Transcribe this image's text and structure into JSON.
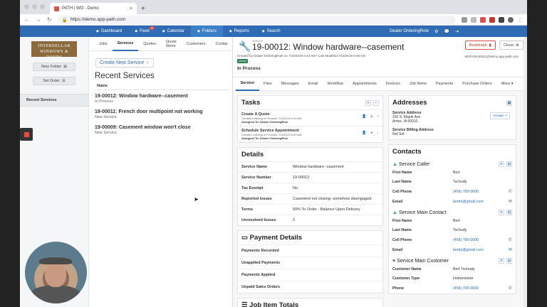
{
  "browser": {
    "tab_title": "PATH | WO - Demo",
    "url": "https://demo.app-path.com",
    "new_tab": "+",
    "close_tab": "×"
  },
  "nav": {
    "items": [
      {
        "label": "Dashboard",
        "icon": "dashboard-icon"
      },
      {
        "label": "Feed",
        "icon": "feed-icon",
        "badge": "6"
      },
      {
        "label": "Calendar",
        "icon": "calendar-icon"
      },
      {
        "label": "Folders",
        "icon": "folder-icon",
        "active": true
      },
      {
        "label": "Reports",
        "icon": "reports-icon"
      },
      {
        "label": "Search",
        "icon": "search-icon"
      }
    ],
    "user": "Dealer OrderingRole"
  },
  "sidebar": {
    "logo_line1": "INTERSELLAR",
    "logo_line2": "WINDOWS & DOORS",
    "new_folder": "New Folder",
    "set_order": "Set Order",
    "section": "Recent Services"
  },
  "middle": {
    "tabs": [
      "Jobs",
      "Services",
      "Quotes",
      "Quote Items",
      "Customers",
      "Contac"
    ],
    "active_tab": "Services",
    "create_button": "Create New Service",
    "heading": "Recent Services",
    "column_header": "Name",
    "services": [
      {
        "title": "19-00012: Window hardware--casement",
        "status": "In Process"
      },
      {
        "title": "19-00011: French door multipoint not working",
        "status": "New Service"
      },
      {
        "title": "19-00009: Casement window won't close",
        "status": "New Service"
      }
    ]
  },
  "detail": {
    "type_label": "SERVICE",
    "title": "19-00012: Window hardware--casement",
    "created_by": "Created by Dealer OrderingRole on 7/15/2019 6:43 AM • Last Modified 7/15/2019 6:49 AM",
    "tag": "#Active",
    "status": "In Process",
    "bookmark": "Bookmark",
    "close": "Close",
    "service_id": "SERV19-00012@demo.app-path.com",
    "tabs": [
      "Service",
      "Files",
      "Messages",
      "Email",
      "Workflow",
      "Appointments",
      "Invoices",
      "Job Items",
      "Payments",
      "Purchase Orders",
      "More"
    ],
    "tasks_heading": "Tasks",
    "tasks": [
      {
        "name": "Create A Quote",
        "meta": "Created entering In Process 7/15/2019 6:49 AM",
        "assigned": "Assigned To: Dealer OrderingRole"
      },
      {
        "name": "Schedule Service Appointment",
        "meta": "Created entering In Process 7/15/2019 6:49 AM",
        "assigned": "Assigned To: Dealer OrderingRole"
      }
    ],
    "details_heading": "Details",
    "details": [
      {
        "k": "Service Name",
        "v": "Window hardware--casement"
      },
      {
        "k": "Service Number",
        "v": "19-00012"
      },
      {
        "k": "Tax Exempt",
        "v": "No"
      },
      {
        "k": "Reported Issues",
        "v": "Casement not closing--somehow disengaged."
      },
      {
        "k": "Terms",
        "v": "50% To Order - Balance Upon Delivery"
      },
      {
        "k": "Unresolved Issues",
        "v": "2"
      }
    ],
    "payment_heading": "Payment Details",
    "payments": [
      "Payments Recorded",
      "Unapplied Payments",
      "Payments Applied",
      "Unpaid Sales Orders"
    ],
    "jobitems_heading": "Job Item Totals",
    "addresses_heading": "Addresses",
    "service_address_label": "Service Address",
    "service_address_1": "310 S. Maple Ave",
    "service_address_2": "Ames, IA 50010",
    "google": "Google",
    "billing_label": "Service Billing Address",
    "billing_value": "Not Set",
    "contacts_heading": "Contacts",
    "contacts": [
      {
        "title": "Service Caller",
        "rows": [
          {
            "k": "First Name",
            "v": "Bert"
          },
          {
            "k": "Last Name",
            "v": "Tschudy"
          },
          {
            "k": "Cell Phone",
            "v": "(456) 789-0000",
            "link": true,
            "icon": "phone-icon"
          },
          {
            "k": "Email",
            "v": "bertts@gmail.com",
            "link": true,
            "icon": "mail-icon"
          }
        ]
      },
      {
        "title": "Service Main Contact",
        "rows": [
          {
            "k": "First Name",
            "v": "Bert"
          },
          {
            "k": "Last Name",
            "v": "Tschudy"
          },
          {
            "k": "Cell Phone",
            "v": "(456) 789-0000",
            "link": true,
            "icon": "phone-icon"
          },
          {
            "k": "Email",
            "v": "bertts@gmail.com",
            "link": true,
            "icon": "mail-icon"
          }
        ]
      },
      {
        "title": "Service Main Customer",
        "rows": [
          {
            "k": "Customer Name",
            "v": "Bert Tschudy"
          },
          {
            "k": "Customer Type",
            "v": "Homeowner"
          },
          {
            "k": "Phone",
            "v": "(456) 789-0000",
            "link": true,
            "icon": "phone-icon"
          }
        ]
      }
    ]
  },
  "colors": {
    "nav": "#2f6cb3",
    "accent": "#2f6cb3",
    "danger": "#d9534f",
    "active_tag": "#2e7d4f"
  }
}
